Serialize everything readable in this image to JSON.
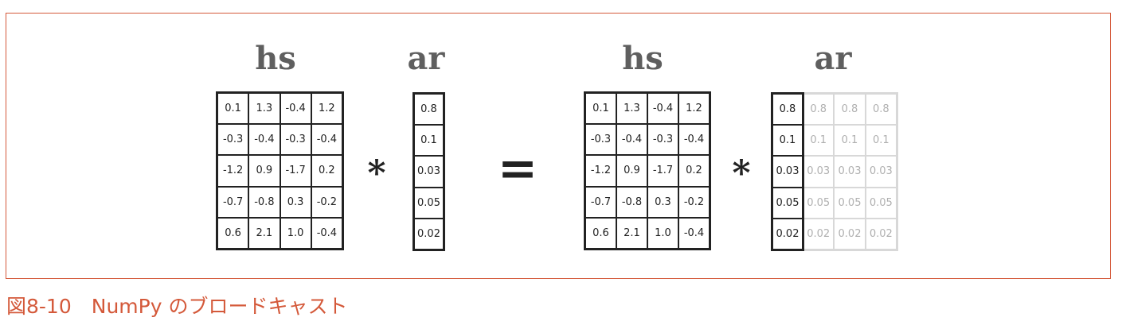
{
  "figure": {
    "caption": "図8-10　NumPy のブロードキャスト",
    "left": {
      "hs_label": "hs",
      "ar_label": "ar",
      "operator": "*"
    },
    "equals": "=",
    "right": {
      "hs_label": "hs",
      "ar_label": "ar",
      "operator": "*"
    },
    "hs_values": [
      [
        "0.1",
        "1.3",
        "-0.4",
        "1.2"
      ],
      [
        "-0.3",
        "-0.4",
        "-0.3",
        "-0.4"
      ],
      [
        "-1.2",
        "0.9",
        "-1.7",
        "0.2"
      ],
      [
        "-0.7",
        "-0.8",
        "0.3",
        "-0.2"
      ],
      [
        "0.6",
        "2.1",
        "1.0",
        "-0.4"
      ]
    ],
    "ar_values": [
      "0.8",
      "0.1",
      "0.03",
      "0.05",
      "0.02"
    ],
    "broadcast_copies": 3,
    "colors": {
      "frame": "#d4593a",
      "caption": "#d4593a",
      "ghost": "#b0b0b0",
      "label": "#5f5f5f"
    }
  }
}
